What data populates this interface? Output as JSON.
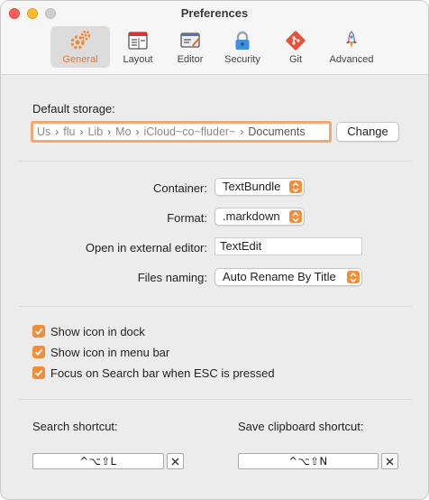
{
  "window": {
    "title": "Preferences"
  },
  "toolbar": {
    "tabs": [
      {
        "label": "General",
        "icon": "gear-icon",
        "active": true
      },
      {
        "label": "Layout",
        "icon": "layout-icon",
        "active": false
      },
      {
        "label": "Editor",
        "icon": "editor-icon",
        "active": false
      },
      {
        "label": "Security",
        "icon": "lock-icon",
        "active": false
      },
      {
        "label": "Git",
        "icon": "git-icon",
        "active": false
      },
      {
        "label": "Advanced",
        "icon": "rocket-icon",
        "active": false
      }
    ]
  },
  "storage": {
    "label": "Default storage:",
    "path": [
      "Us",
      "flu",
      "Lib",
      "Mo",
      "iCloud~co~fluder~",
      "Documents"
    ],
    "change_label": "Change"
  },
  "settings": {
    "container_label": "Container:",
    "container_value": "TextBundle",
    "format_label": "Format:",
    "format_value": ".markdown",
    "editor_label": "Open in external editor:",
    "editor_value": "TextEdit",
    "naming_label": "Files naming:",
    "naming_value": "Auto Rename By Title"
  },
  "options": [
    {
      "label": "Show icon in dock",
      "checked": true
    },
    {
      "label": "Show icon in menu bar",
      "checked": true
    },
    {
      "label": "Focus on Search bar when ESC is pressed",
      "checked": true
    }
  ],
  "shortcuts": {
    "search_label": "Search shortcut:",
    "search_value": "^⌥⇧L",
    "clipboard_label": "Save clipboard shortcut:",
    "clipboard_value": "^⌥⇧N"
  },
  "colors": {
    "accent": "#f18e3b",
    "focus_ring": "#f3a772"
  }
}
